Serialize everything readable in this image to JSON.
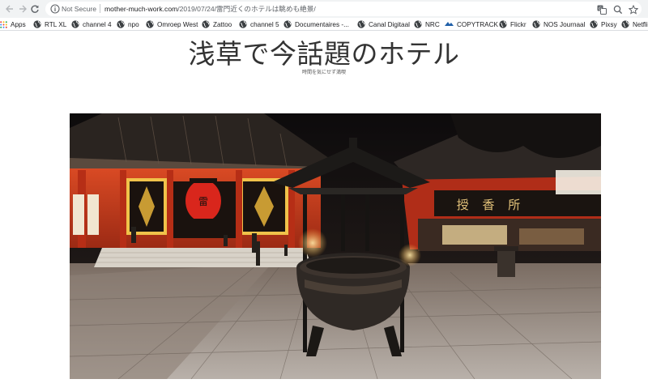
{
  "browser": {
    "security_label": "Not Secure",
    "url_host": "mother-much-work.com",
    "url_path": "/2019/07/24/雷門近くのホテルは眺めも絶景/",
    "icons": {
      "back": "arrow-left-icon",
      "forward": "arrow-right-icon",
      "reload": "reload-icon",
      "info": "info-icon",
      "translate": "translate-icon",
      "zoom": "magnifier-icon",
      "bookmark": "star-icon"
    }
  },
  "bookmarks": [
    {
      "label": "Apps",
      "icon": "apps-grid-icon"
    },
    {
      "label": "RTL XL",
      "icon": "globe-icon"
    },
    {
      "label": "channel 4",
      "icon": "globe-icon"
    },
    {
      "label": "npo",
      "icon": "globe-icon"
    },
    {
      "label": "Omroep West",
      "icon": "globe-icon"
    },
    {
      "label": "Zattoo",
      "icon": "globe-icon"
    },
    {
      "label": "channel 5",
      "icon": "globe-icon"
    },
    {
      "label": "Documentaires -...",
      "icon": "globe-icon"
    },
    {
      "label": "Canal Digitaal",
      "icon": "globe-icon"
    },
    {
      "label": "NRC",
      "icon": "globe-icon"
    },
    {
      "label": "COPYTRACK",
      "icon": "copytrack-icon"
    },
    {
      "label": "Flickr",
      "icon": "globe-icon"
    },
    {
      "label": "NOS Journaal",
      "icon": "globe-icon"
    },
    {
      "label": "Pixsy",
      "icon": "globe-icon"
    },
    {
      "label": "Netfli",
      "icon": "globe-icon"
    }
  ],
  "page": {
    "site_title": "浅草で今話題のホテル",
    "tagline": "時間を気にせず満喫"
  },
  "hero_image": {
    "subject": "Senso-ji temple at night with incense burner in foreground",
    "sign_text": "授 香 所"
  },
  "colors": {
    "toolbar_bg": "#f1f3f4",
    "omnibox_bg": "#ffffff",
    "temple_red": "#c63a1e",
    "roof_dark": "#2a2420",
    "lantern": "#d9261c",
    "lamp_glow": "#ffd27a"
  }
}
